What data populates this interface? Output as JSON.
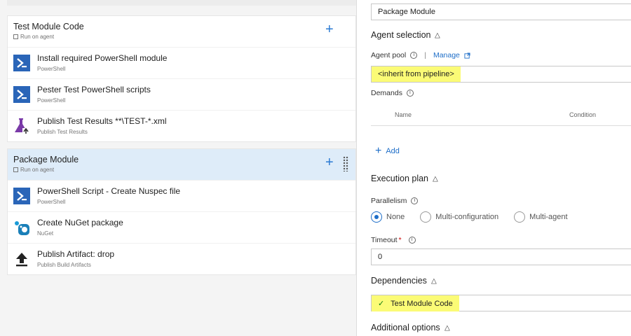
{
  "phases": [
    {
      "title": "Test Module Code",
      "subtitle": "Run on agent",
      "tasks": [
        {
          "title": "Install required PowerShell module",
          "subtitle": "PowerShell",
          "icon": "powershell-icon"
        },
        {
          "title": "Pester Test PowerShell scripts",
          "subtitle": "PowerShell",
          "icon": "powershell-icon"
        },
        {
          "title": "Publish Test Results **\\TEST-*.xml",
          "subtitle": "Publish Test Results",
          "icon": "flask-icon"
        }
      ]
    },
    {
      "title": "Package Module",
      "subtitle": "Run on agent",
      "tasks": [
        {
          "title": "PowerShell Script - Create Nuspec file",
          "subtitle": "PowerShell",
          "icon": "powershell-icon"
        },
        {
          "title": "Create NuGet package",
          "subtitle": "NuGet",
          "icon": "nuget-icon"
        },
        {
          "title": "Publish Artifact: drop",
          "subtitle": "Publish Build Artifacts",
          "icon": "upload-icon"
        }
      ]
    }
  ],
  "details": {
    "display_name": "Package Module",
    "agent_selection": {
      "heading": "Agent selection",
      "agent_pool_label": "Agent pool",
      "separator": "|",
      "manage_label": "Manage",
      "agent_pool_value": "<inherit from pipeline>",
      "demands_label": "Demands",
      "demands_columns": [
        "Name",
        "Condition"
      ],
      "add_label": "Add"
    },
    "execution_plan": {
      "heading": "Execution plan",
      "parallelism_label": "Parallelism",
      "options": [
        "None",
        "Multi-configuration",
        "Multi-agent"
      ],
      "selected": "None",
      "timeout_label": "Timeout",
      "timeout_required": "*",
      "timeout_value": "0"
    },
    "dependencies": {
      "heading": "Dependencies",
      "selected_dependency": "Test Module Code"
    },
    "additional_options_heading": "Additional options"
  },
  "colors": {
    "accent": "#1e6ec8",
    "selected_phase_bg": "#deecf9",
    "highlight": "#fbfb76"
  }
}
